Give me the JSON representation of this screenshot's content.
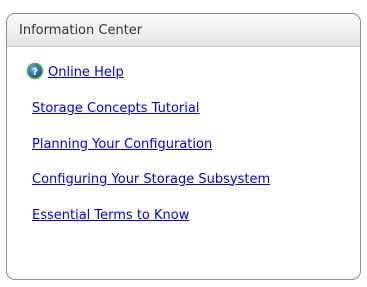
{
  "panel": {
    "title": "Information Center"
  },
  "icons": {
    "help": "help-icon"
  },
  "links": [
    {
      "label": "Online Help"
    },
    {
      "label": "Storage Concepts Tutorial"
    },
    {
      "label": "Planning Your Configuration"
    },
    {
      "label": "Configuring Your Storage Subsystem"
    },
    {
      "label": "Essential Terms to Know"
    }
  ],
  "colors": {
    "link": "#0000ee",
    "border": "#8c8c8c",
    "icon_blue": "#2a6fd1",
    "icon_green": "#5bb531"
  }
}
